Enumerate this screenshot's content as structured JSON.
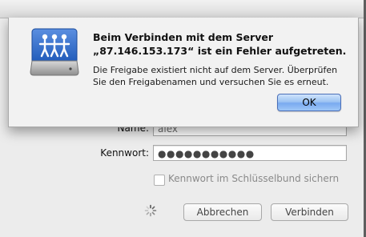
{
  "alert": {
    "title_line1": "Beim Verbinden mit dem Server",
    "title_line2": "„87.146.153.173“ ist ein Fehler aufgetreten.",
    "message": "Die Freigabe existiert nicht auf dem Server. Überprüfen Sie den Freigabenamen und versuchen Sie es erneut.",
    "ok_label": "OK"
  },
  "login": {
    "name_label": "Name:",
    "name_value": "alex",
    "password_label": "Kennwort:",
    "password_value": "●●●●●●●●●●●",
    "keychain_label": "Kennwort im Schlüsselbund sichern",
    "cancel_label": "Abbrechen",
    "connect_label": "Verbinden"
  },
  "colors": {
    "primary_button": "#79aaf0",
    "icon_blue": "#2f6fd1"
  }
}
